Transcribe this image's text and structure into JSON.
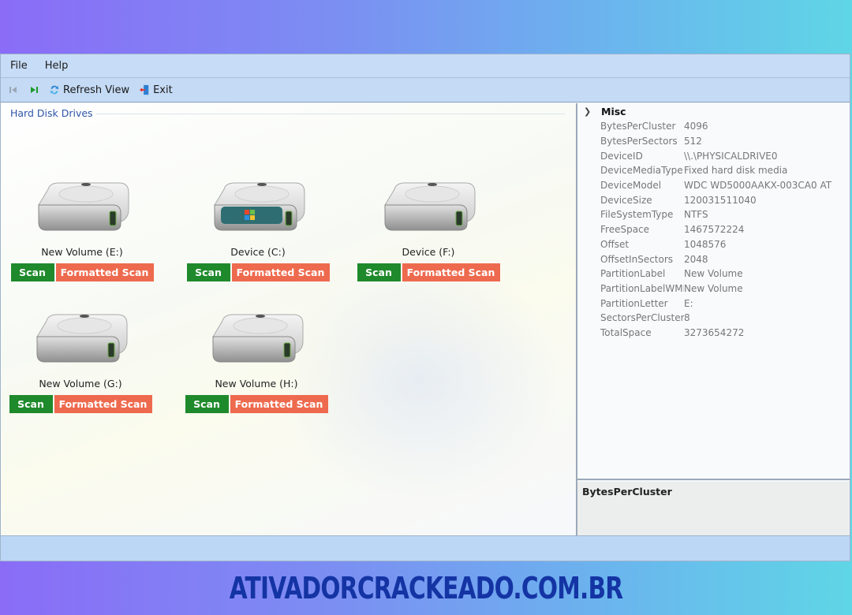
{
  "menu": {
    "file": "File",
    "help": "Help"
  },
  "toolbar": {
    "first_icon": "skip-first-icon",
    "last_icon": "skip-last-icon",
    "refresh_label": "Refresh View",
    "exit_label": "Exit"
  },
  "left_panel": {
    "group_title": "Hard Disk Drives",
    "drives": [
      {
        "label": "New Volume (E:)",
        "scan": "Scan",
        "formatted_scan": "Formatted Scan",
        "system": false
      },
      {
        "label": "Device (C:)",
        "scan": "Scan",
        "formatted_scan": "Formatted Scan",
        "system": true
      },
      {
        "label": "Device (F:)",
        "scan": "Scan",
        "formatted_scan": "Formatted Scan",
        "system": false
      },
      {
        "label": "New Volume (G:)",
        "scan": "Scan",
        "formatted_scan": "Formatted Scan",
        "system": false
      },
      {
        "label": "New Volume (H:)",
        "scan": "Scan",
        "formatted_scan": "Formatted Scan",
        "system": false
      }
    ]
  },
  "property_grid": {
    "category": "Misc",
    "rows": [
      {
        "name": "BytesPerCluster",
        "value": "4096"
      },
      {
        "name": "BytesPerSectors",
        "value": "512"
      },
      {
        "name": "DeviceID",
        "value": "\\\\.\\PHYSICALDRIVE0"
      },
      {
        "name": "DeviceMediaType",
        "value": "Fixed hard disk media"
      },
      {
        "name": "DeviceModel",
        "value": "WDC WD5000AAKX-003CA0 AT"
      },
      {
        "name": "DeviceSize",
        "value": "120031511040"
      },
      {
        "name": "FileSystemType",
        "value": "NTFS"
      },
      {
        "name": "FreeSpace",
        "value": "1467572224"
      },
      {
        "name": "Offset",
        "value": "1048576"
      },
      {
        "name": "OffsetInSectors",
        "value": "2048"
      },
      {
        "name": "PartitionLabel",
        "value": "New Volume"
      },
      {
        "name": "PartitionLabelWMI",
        "value": "New Volume"
      },
      {
        "name": "PartitionLetter",
        "value": "E:"
      },
      {
        "name": "SectorsPerCluster",
        "value": "8"
      },
      {
        "name": "TotalSpace",
        "value": "3273654272"
      }
    ],
    "description_title": "BytesPerCluster"
  },
  "colors": {
    "scan": "#1f8a2c",
    "formatted_scan": "#ee6a4e",
    "accent": "#2e55a8"
  },
  "watermark": "ATIVADORCRACKEADO.COM.BR"
}
